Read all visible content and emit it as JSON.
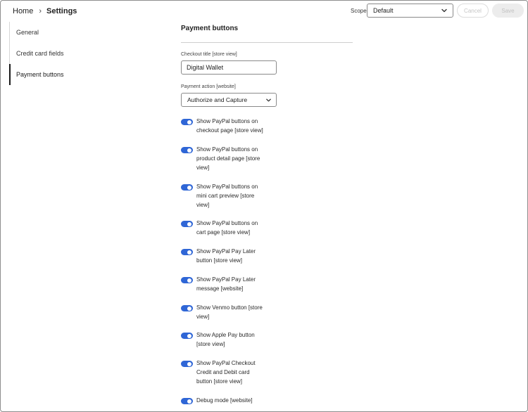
{
  "breadcrumb": {
    "home": "Home",
    "separator": "›",
    "current": "Settings"
  },
  "scope": {
    "label": "Scope",
    "selected": "Default"
  },
  "actions": {
    "cancel_label": "Cancel",
    "save_label": "Save"
  },
  "sidebar": {
    "items": [
      {
        "label": "General",
        "active": false
      },
      {
        "label": "Credit card fields",
        "active": false
      },
      {
        "label": "Payment buttons",
        "active": true
      }
    ]
  },
  "main": {
    "section_title": "Payment buttons",
    "checkout_title": {
      "label": "Checkout title [store view]",
      "value": "Digital Wallet"
    },
    "payment_action": {
      "label": "Payment action [website]",
      "selected": "Authorize and Capture"
    },
    "toggles": [
      {
        "line1": "Show PayPal buttons on",
        "line2": "checkout page [store view]",
        "line3": "",
        "on": true
      },
      {
        "line1": "Show PayPal buttons on",
        "line2": "product detail page [store",
        "line3": "view]",
        "on": true
      },
      {
        "line1": "Show PayPal buttons on",
        "line2": "mini cart preview [store",
        "line3": "view]",
        "on": true
      },
      {
        "line1": "Show PayPal buttons on",
        "line2": "cart page [store view]",
        "line3": "",
        "on": true
      },
      {
        "line1": "Show PayPal Pay Later",
        "line2": "button [store view]",
        "line3": "",
        "on": true
      },
      {
        "line1": "Show PayPal Pay Later",
        "line2": "message [website]",
        "line3": "",
        "on": true
      },
      {
        "line1": "Show Venmo button [store",
        "line2": "view]",
        "line3": "",
        "on": true
      },
      {
        "line1": "Show Apple Pay button",
        "line2": "[store view]",
        "line3": "",
        "on": true
      },
      {
        "line1": "Show PayPal Checkout",
        "line2": "Credit and Debit card",
        "line3": "button [store view]",
        "on": true
      },
      {
        "line1": "Debug mode [website]",
        "line2": "",
        "line3": "",
        "on": true
      }
    ]
  },
  "colors": {
    "accent": "#2f66d6",
    "border": "#8a8a8a",
    "active_nav": "#1a1a1a"
  }
}
